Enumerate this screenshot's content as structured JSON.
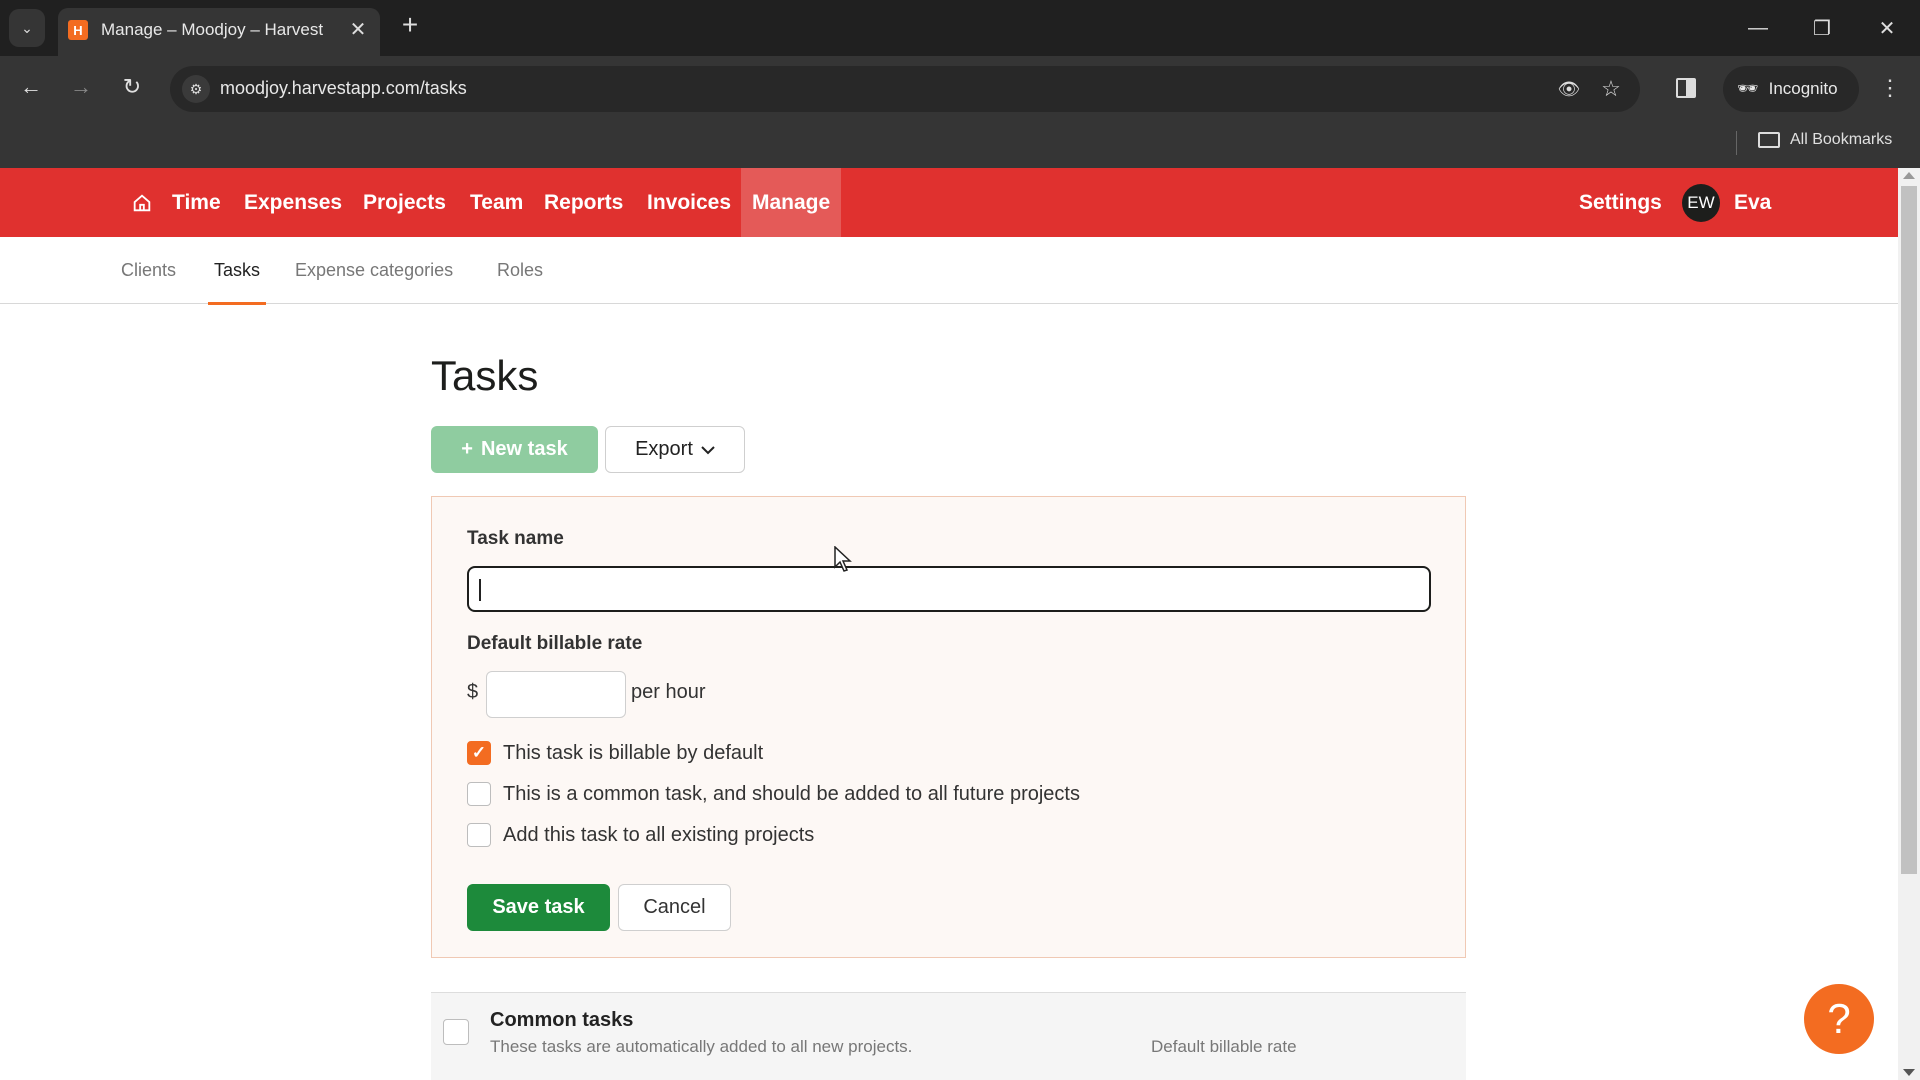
{
  "browser": {
    "tab_title": "Manage – Moodjoy – Harvest",
    "favicon_letter": "H",
    "url": "moodjoy.harvestapp.com/tasks",
    "profile_label": "Incognito",
    "bookmarks_label": "All Bookmarks",
    "icons": {
      "tab_search": "chevron-down-icon",
      "close_tab": "close-icon",
      "new_tab": "plus-icon",
      "back": "arrow-left-icon",
      "forward": "arrow-right-icon",
      "reload": "reload-icon",
      "site_info": "tune-icon",
      "tracking": "eye-off-icon",
      "bookmark": "star-icon",
      "side_panel": "side-panel-icon",
      "incognito": "incognito-icon",
      "menu": "more-vertical-icon",
      "folder": "folder-icon"
    }
  },
  "topnav": {
    "items": [
      {
        "label": "Time",
        "active": false
      },
      {
        "label": "Expenses",
        "active": false
      },
      {
        "label": "Projects",
        "active": false
      },
      {
        "label": "Team",
        "active": false
      },
      {
        "label": "Reports",
        "active": false
      },
      {
        "label": "Invoices",
        "active": false
      },
      {
        "label": "Manage",
        "active": true
      }
    ],
    "settings_label": "Settings",
    "avatar_initials": "EW",
    "user_name": "Eva",
    "brand_color": "#e0312f"
  },
  "subnav": {
    "items": [
      {
        "label": "Clients",
        "active": false
      },
      {
        "label": "Tasks",
        "active": true
      },
      {
        "label": "Expense categories",
        "active": false
      },
      {
        "label": "Roles",
        "active": false
      }
    ]
  },
  "page": {
    "title": "Tasks",
    "new_task_label": "New task",
    "new_task_icon": "+",
    "export_label": "Export"
  },
  "form": {
    "task_name_label": "Task name",
    "task_name_value": "",
    "rate_label": "Default billable rate",
    "currency_symbol": "$",
    "rate_value": "",
    "rate_suffix": "per hour",
    "checkboxes": [
      {
        "label": "This task is billable by default",
        "checked": true
      },
      {
        "label": "This is a common task, and should be added to all future projects",
        "checked": false
      },
      {
        "label": "Add this task to all existing projects",
        "checked": false
      }
    ],
    "save_label": "Save task",
    "cancel_label": "Cancel"
  },
  "common_tasks": {
    "title": "Common tasks",
    "description": "These tasks are automatically added to all new projects.",
    "rate_header": "Default billable rate"
  },
  "help": {
    "icon": "?"
  },
  "colors": {
    "accent_orange": "#f36c21",
    "save_green": "#1d8a3b",
    "new_task_green": "#8fcca0"
  }
}
